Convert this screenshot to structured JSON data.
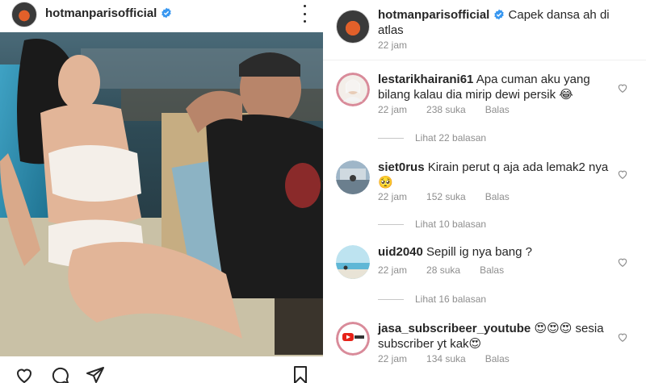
{
  "post": {
    "username": "hotmanparisofficial",
    "verified": true
  },
  "caption": {
    "username": "hotmanparisofficial",
    "text": "Capek dansa ah di atlas",
    "time": "22 jam"
  },
  "comments": [
    {
      "username": "lestarikhairani61",
      "text": "Apa cuman aku yang bilang kalau dia mirip dewi persik 😂",
      "time": "22 jam",
      "likes": "238 suka",
      "reply_label": "Balas",
      "view_replies": "Lihat 22 balasan"
    },
    {
      "username": "siet0rus",
      "text": "Kirain perut q aja ada lemak2 nya 🥺",
      "time": "22 jam",
      "likes": "152 suka",
      "reply_label": "Balas",
      "view_replies": "Lihat 10 balasan"
    },
    {
      "username": "uid2040",
      "text": "Sepill ig nya bang ?",
      "time": "22 jam",
      "likes": "28 suka",
      "reply_label": "Balas",
      "view_replies": "Lihat 16 balasan"
    },
    {
      "username": "jasa_subscribeer_youtube",
      "text": "😍😍😍 sesia subscriber yt kak😍",
      "time": "22 jam",
      "likes": "134 suka",
      "reply_label": "Balas"
    }
  ],
  "icons": {
    "verified": "verified-badge-icon",
    "more": "more-options-icon",
    "like": "heart-icon",
    "comment": "comment-icon",
    "share": "share-icon",
    "save": "bookmark-icon"
  },
  "colors": {
    "verified_blue": "#3897f0",
    "muted_text": "#8e8e8e"
  }
}
